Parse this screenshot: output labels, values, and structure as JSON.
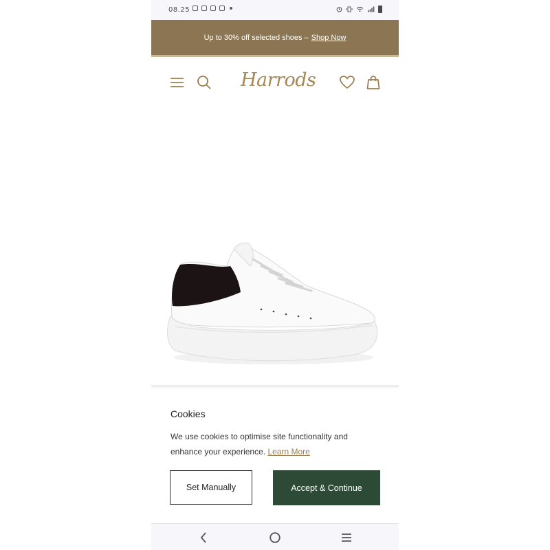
{
  "status_bar": {
    "time": "08.25"
  },
  "promo": {
    "text": "Up to 30% off selected shoes –",
    "link": "Shop Now"
  },
  "header": {
    "logo": "Harrods",
    "icons": [
      "menu-icon",
      "search-icon",
      "heart-icon",
      "bag-icon"
    ]
  },
  "product": {
    "image": "white-sneaker-black-heel"
  },
  "cookies": {
    "title": "Cookies",
    "text": "We use cookies to optimise site functionality and enhance your experience.",
    "learn_more": "Learn More",
    "set_manually_label": "Set Manually",
    "accept_label": "Accept & Continue"
  },
  "colors": {
    "banner": "#8c7553",
    "logo": "#a58755",
    "accept_button": "#2d4a37",
    "link": "#9b7d4e"
  },
  "nav": {
    "icons": [
      "back-icon",
      "home-icon",
      "recents-icon"
    ]
  }
}
